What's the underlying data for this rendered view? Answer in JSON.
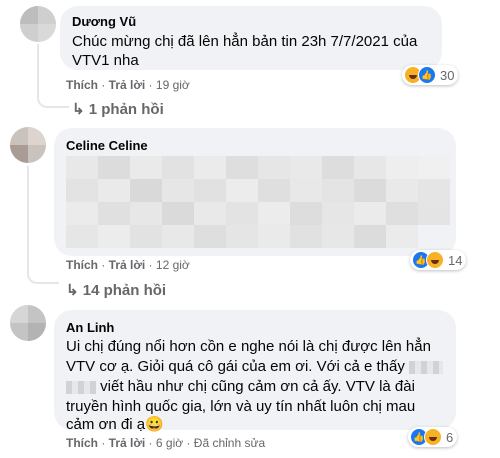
{
  "comments": [
    {
      "author": "Dương Vũ",
      "text_lines": [
        "Chúc mừng chị đã lên hẳn bản tin 23h 7/7/2021 của",
        "VTV1 nha"
      ],
      "like_label": "Thích",
      "reply_label": "Trả lời",
      "time": "19 giờ",
      "reaction_count": "30",
      "replies_label": "1 phản hồi"
    },
    {
      "author": "Celine Celine",
      "like_label": "Thích",
      "reply_label": "Trả lời",
      "time": "12 giờ",
      "reaction_count": "14",
      "replies_label": "14 phản hồi"
    },
    {
      "author": "An Linh",
      "text_lines": [
        "Ui chị đúng nổi hơn cồn e nghe nói là chị được lên hẳn",
        "VTV cơ ạ. Giỏi quá cô gái của em ơi. Với cả e thấy",
        "viết hầu như chị cũng cảm ơn cả ấy. VTV là đài",
        "truyền hình quốc gia, lớn và uy tín nhất luôn chị mau",
        "cảm ơn đi ạ😀"
      ],
      "like_label": "Thích",
      "reply_label": "Trả lời",
      "time": "6 giờ",
      "edited_label": "Đã chỉnh sửa",
      "reaction_count": "6"
    }
  ],
  "colors": {
    "bubble": "#f0f2f5",
    "meta": "#65676b",
    "like": "#1877f2",
    "haha": "#f7b125"
  }
}
